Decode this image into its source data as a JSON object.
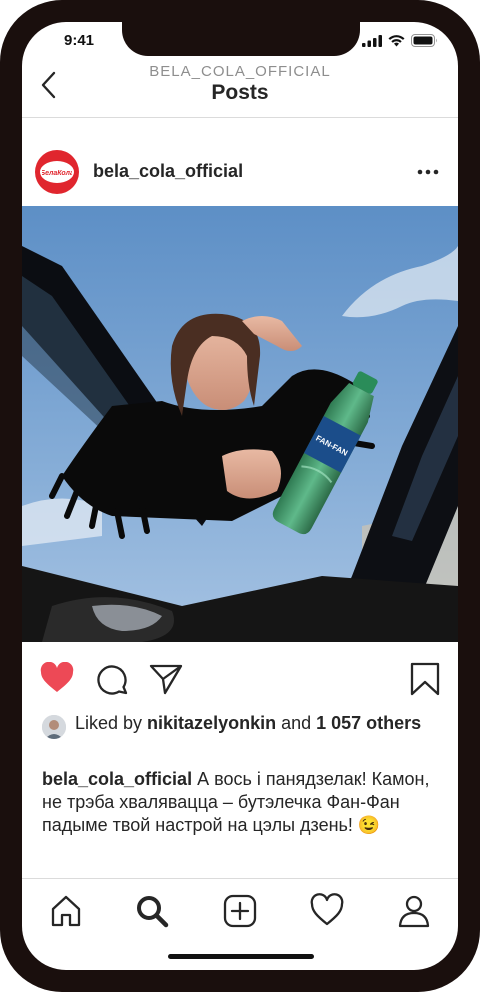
{
  "status_bar": {
    "time": "9:41"
  },
  "nav": {
    "subtitle": "BELA_COLA_OFFICIAL",
    "title": "Posts"
  },
  "post": {
    "username": "bela_cola_official",
    "avatar_logo_text": "БелаКола",
    "bottle_label_text": "FAN-FAN",
    "liked": true,
    "likes": {
      "prefix": "Liked by ",
      "user": "nikitazelyonkin",
      "middle": " and ",
      "count": "1 057 others"
    },
    "caption": {
      "username": "bela_cola_official",
      "text": " А вось і панядзелак! Камон, не трэба хваляваццa – бутэлечка Фан-Фан падыме твой настрой на цэлы дзень! 😉"
    }
  },
  "colors": {
    "like_red": "#ed4956",
    "brand_red": "#e0262e",
    "text": "#262626",
    "muted": "#8e8e8e",
    "frame": "#1a0f0d"
  },
  "icons": {
    "back": "chevron-left-icon",
    "more": "more-horizontal-icon",
    "like": "heart-filled-icon",
    "comment": "comment-icon",
    "share": "paper-plane-icon",
    "save": "bookmark-icon",
    "tabs": [
      "home-icon",
      "search-icon",
      "add-icon",
      "activity-heart-icon",
      "profile-icon"
    ]
  }
}
